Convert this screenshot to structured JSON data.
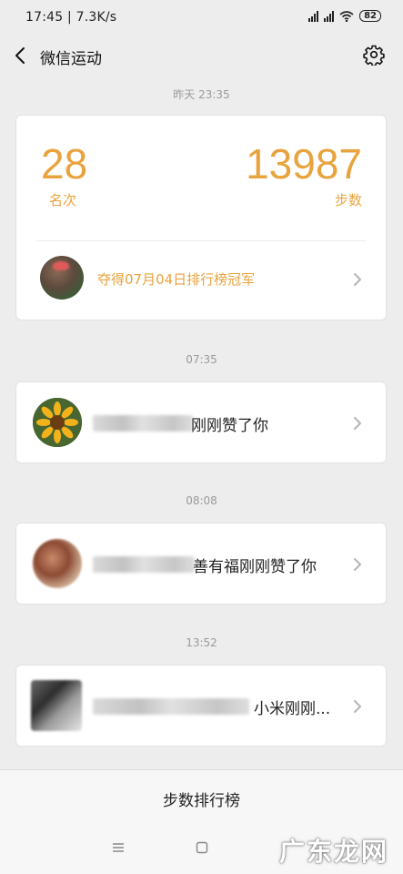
{
  "status_bar": {
    "time": "17:45",
    "speed": "7.3K/s",
    "battery": "82"
  },
  "nav": {
    "title": "微信运动"
  },
  "timestamps": [
    "昨天 23:35",
    "07:35",
    "08:08",
    "13:52"
  ],
  "summary": {
    "rank_value": "28",
    "rank_label": "名次",
    "steps_value": "13987",
    "steps_label": "步数",
    "champion_text": "夺得07月04日排行榜冠军"
  },
  "likes": [
    {
      "visible_text": "刚刚赞了你"
    },
    {
      "visible_text": "善有福刚刚赞了你"
    },
    {
      "visible_text": "小米刚刚..."
    }
  ],
  "bottom": {
    "rank_button": "步数排行榜",
    "watermark": "广东龙网"
  },
  "colors": {
    "accent": "#e8a33d",
    "background": "#ededed",
    "card": "#ffffff"
  }
}
